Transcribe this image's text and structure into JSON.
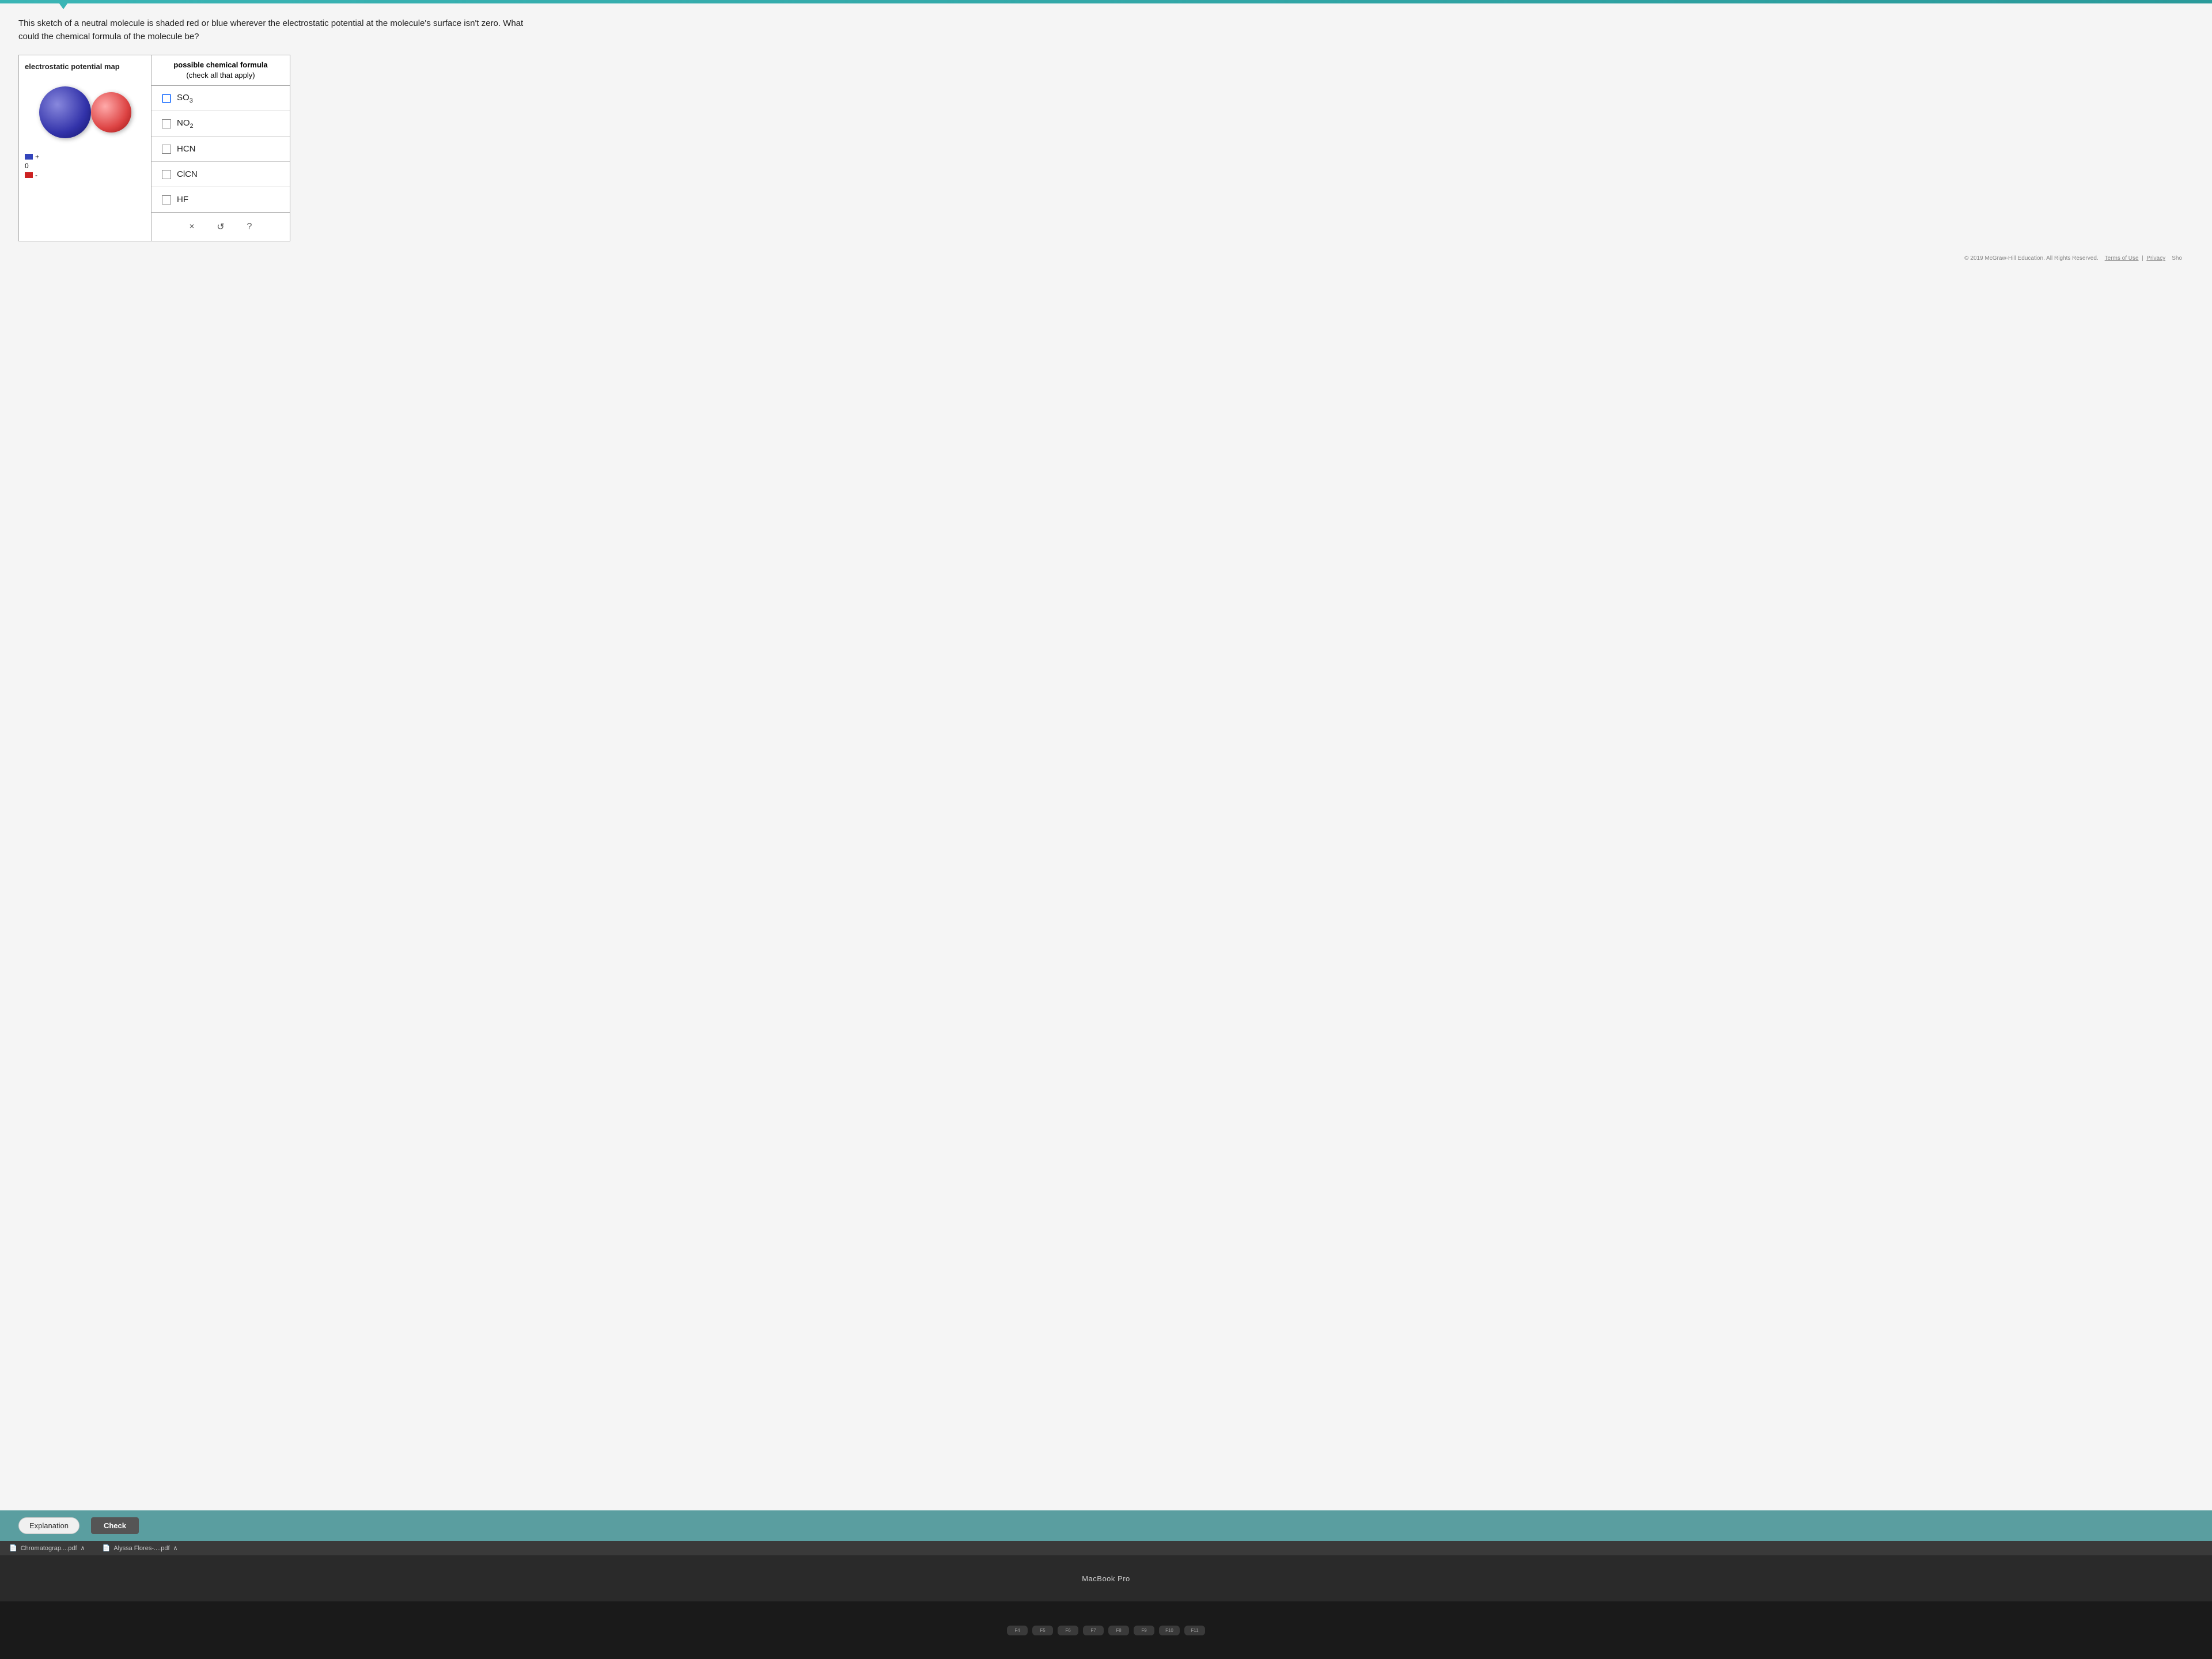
{
  "top_bar": {
    "color": "#3ab5b5"
  },
  "question": {
    "text": "This sketch of a neutral molecule is shaded red or blue wherever the electrostatic potential at the molecule's surface isn't zero. What could the chemical formula of the molecule be?"
  },
  "table": {
    "left_header": "electrostatic potential map",
    "right_header_line1": "possible chemical formula",
    "right_header_line2": "(check all that apply)",
    "options": [
      {
        "id": "so3",
        "formula_parts": [
          {
            "text": "SO"
          },
          {
            "sub": "3"
          }
        ],
        "checked": true
      },
      {
        "id": "no2",
        "formula_parts": [
          {
            "text": "NO"
          },
          {
            "sub": "2"
          }
        ],
        "checked": false
      },
      {
        "id": "hcn",
        "formula_parts": [
          {
            "text": "HCN"
          }
        ],
        "checked": false
      },
      {
        "id": "clcn",
        "formula_parts": [
          {
            "text": "ClCN"
          }
        ],
        "checked": false
      },
      {
        "id": "hf",
        "formula_parts": [
          {
            "text": "HF"
          }
        ],
        "checked": false
      }
    ]
  },
  "actions": {
    "clear_label": "×",
    "undo_label": "↺",
    "help_label": "?"
  },
  "bottom_buttons": {
    "explanation_label": "Explanation",
    "check_label": "Check"
  },
  "copyright": {
    "text": "© 2019 McGraw-Hill Education. All Rights Reserved.",
    "terms_label": "Terms of Use",
    "privacy_label": "Privacy",
    "show_label": "Sho"
  },
  "file_tabs": [
    {
      "label": "Chromatograp....pdf"
    },
    {
      "label": "Alyssa Flores-....pdf"
    }
  ],
  "dock": {
    "label": "MacBook Pro"
  },
  "legend": {
    "plus": "+",
    "zero": "0",
    "minus": "-"
  },
  "keyboard_keys": [
    {
      "label": "F4"
    },
    {
      "label": "F5"
    },
    {
      "label": "F6"
    },
    {
      "label": "F7"
    },
    {
      "label": "F8"
    },
    {
      "label": "F9"
    },
    {
      "label": "F10"
    },
    {
      "label": "F11"
    }
  ]
}
